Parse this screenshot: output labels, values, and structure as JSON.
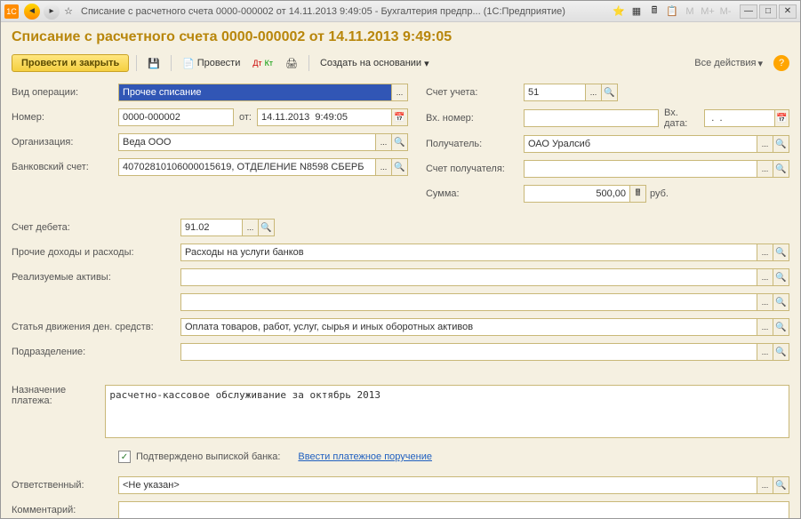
{
  "titlebar": {
    "app_icon": "1С",
    "title": "Списание с расчетного счета 0000-000002 от 14.11.2013 9:49:05 - Бухгалтерия предпр...   (1С:Предприятие)",
    "calc_m": "M",
    "calc_mp": "M+",
    "calc_mm": "M-"
  },
  "header": {
    "title": "Списание с расчетного счета 0000-000002 от 14.11.2013 9:49:05"
  },
  "toolbar": {
    "submit_close": "Провести и закрыть",
    "post": "Провести",
    "create_from": "Создать на основании",
    "all_actions": "Все действия"
  },
  "labels": {
    "op_type": "Вид операции:",
    "number": "Номер:",
    "from": "от:",
    "org": "Организация:",
    "bank_acc": "Банковский счет:",
    "account": "Счет учета:",
    "in_number": "Вх. номер:",
    "in_date": "Вх. дата:",
    "recipient": "Получатель:",
    "recipient_acc": "Счет получателя:",
    "sum": "Сумма:",
    "rub": "руб.",
    "debit_acc": "Счет дебета:",
    "other_income": "Прочие доходы и расходы:",
    "assets_realized": "Реализуемые активы:",
    "cash_flow": "Статья движения ден. средств:",
    "division": "Подразделение:",
    "purpose_l1": "Назначение",
    "purpose_l2": "платежа:",
    "confirmed": "Подтверждено выпиской банка:",
    "enter_order": "Ввести платежное поручение",
    "responsible": "Ответственный:",
    "comment": "Комментарий:"
  },
  "values": {
    "op_type": "Прочее списание",
    "number": "0000-000002",
    "date": "14.11.2013  9:49:05",
    "org": "Веда ООО",
    "bank_acc": "40702810106000015619, ОТДЕЛЕНИЕ N8598 СБЕРБ",
    "account": "51",
    "in_number": "",
    "in_date": " .  .    ",
    "recipient": "ОАО Уралсиб",
    "recipient_acc": "",
    "sum": "500,00",
    "debit_acc": "91.02",
    "other_income": "Расходы на услуги банков",
    "assets_realized": "",
    "assets_realized2": "",
    "cash_flow": "Оплата товаров, работ, услуг, сырья и иных оборотных активов",
    "division": "",
    "purpose": "расчетно-кассовое обслуживание за октябрь 2013",
    "responsible": "<Не указан>",
    "comment": ""
  }
}
